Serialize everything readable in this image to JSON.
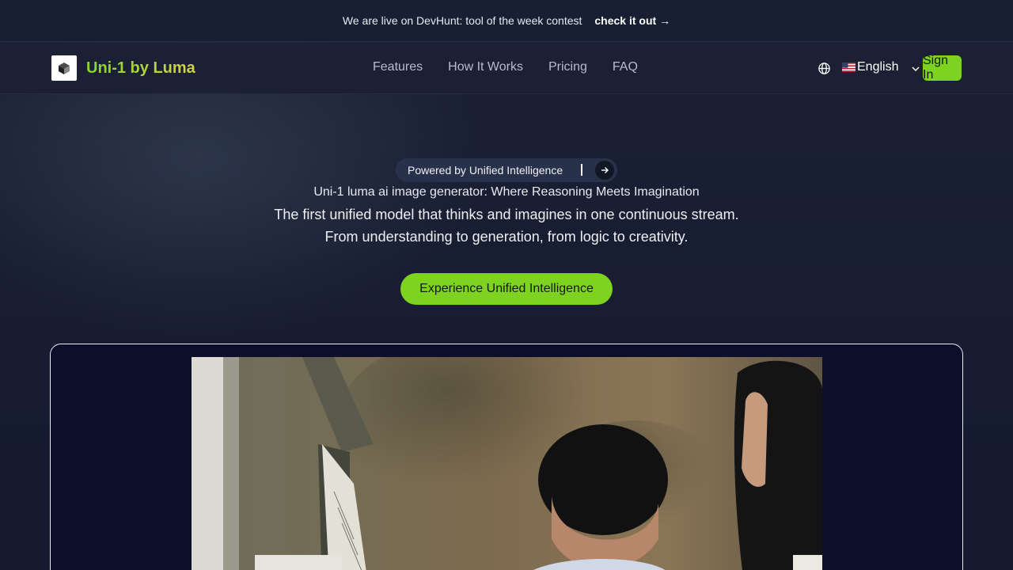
{
  "announcement": {
    "message": "We are live on DevHunt: tool of the week contest",
    "link_label": "check it out →"
  },
  "nav": {
    "brand": "Uni-1 by Luma",
    "links": [
      "Features",
      "How It Works",
      "Pricing",
      "FAQ"
    ],
    "language": "English",
    "sign_in": "Sign In"
  },
  "hero": {
    "pill_label": "Powered by Unified Intelligence",
    "subtitle": "Uni-1 luma ai image generator: Where Reasoning Meets Imagination",
    "description": "The first unified model that thinks and imagines in one continuous stream. From understanding to generation, from logic to creativity.",
    "cta": "Experience Unified Intelligence"
  },
  "colors": {
    "accent": "#7ed321",
    "background": "#171c2e",
    "card": "#0c0e2a"
  },
  "icons": [
    "logo-icon",
    "globe-icon",
    "us-flag-icon",
    "chevron-down-icon",
    "arrow-right-icon"
  ]
}
